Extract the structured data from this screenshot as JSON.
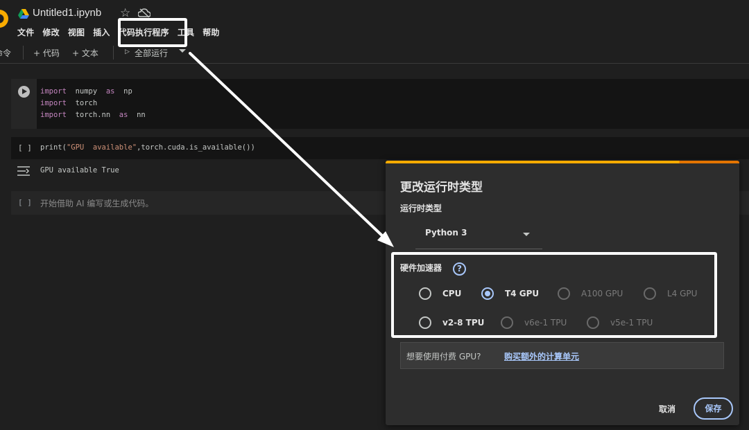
{
  "header": {
    "title": "Untitled1.ipynb",
    "menu": [
      "文件",
      "修改",
      "视图",
      "插入",
      "代码执行程序",
      "工具",
      "帮助"
    ]
  },
  "toolbar": {
    "commands_label": "命令",
    "add_code": "+ 代码",
    "add_text": "+ 文本",
    "run_all": "全部运行"
  },
  "cells": {
    "cell1_lines": [
      {
        "kw": "import",
        "rest": "  numpy  as  np"
      },
      {
        "kw": "import",
        "rest": "  torch"
      },
      {
        "kw": "import",
        "rest": "  torch.nn  as  nn"
      }
    ],
    "cell1_kw_as": "as",
    "cell2_bracket": "[ ]",
    "cell2_pre": "print(",
    "cell2_str": "\"GPU  available\"",
    "cell2_post": ",torch.cuda.is_available())",
    "output": "GPU available True",
    "cell3_bracket": "[ ]",
    "cell3_placeholder": "开始借助 AI 编写或生成代码。"
  },
  "dialog": {
    "title": "更改运行时类型",
    "runtime_label": "运行时类型",
    "runtime_value": "Python 3",
    "hardware_label": "硬件加速器",
    "help_glyph": "?",
    "options": [
      {
        "label": "CPU",
        "checked": false,
        "enabled": true
      },
      {
        "label": "T4 GPU",
        "checked": true,
        "enabled": true
      },
      {
        "label": "A100 GPU",
        "checked": false,
        "enabled": false
      },
      {
        "label": "L4 GPU",
        "checked": false,
        "enabled": false
      },
      {
        "label": "v2-8 TPU",
        "checked": false,
        "enabled": true
      },
      {
        "label": "v6e-1 TPU",
        "checked": false,
        "enabled": false
      },
      {
        "label": "v5e-1 TPU",
        "checked": false,
        "enabled": false
      }
    ],
    "notice_text": "想要使用付费 GPU?",
    "notice_link": "购买额外的计算单元",
    "cancel": "取消",
    "save": "保存"
  },
  "colors": {
    "accent": "#a8c7fa",
    "brand_orange": "#f9ab00",
    "background": "#1f1f1f"
  }
}
